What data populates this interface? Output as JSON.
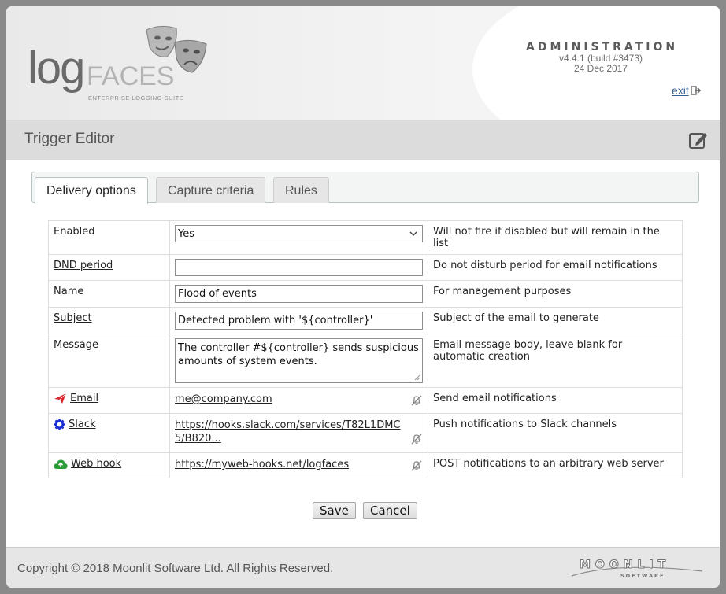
{
  "header": {
    "logo_main": "log",
    "logo_accent": "FACES",
    "logo_tagline": "ENTERPRISE LOGGING SUITE",
    "admin_title": "ADMINISTRATION",
    "version": "v4.4.1 (build #3473)",
    "date": "24 Dec 2017",
    "exit_label": "exit"
  },
  "section": {
    "title": "Trigger Editor"
  },
  "tabs": [
    {
      "label": "Delivery options",
      "active": true
    },
    {
      "label": "Capture criteria",
      "active": false
    },
    {
      "label": "Rules",
      "active": false
    }
  ],
  "form": {
    "enabled": {
      "label": "Enabled",
      "value": "Yes",
      "hint": "Will not fire if disabled but will remain in the list"
    },
    "dnd": {
      "label": "DND period",
      "value": "",
      "hint": "Do not disturb period for email notifications"
    },
    "name": {
      "label": "Name",
      "value": "Flood of events",
      "hint": "For management purposes"
    },
    "subject": {
      "label": "Subject",
      "value": "Detected problem with '${controller}'",
      "hint": "Subject of the email to generate"
    },
    "message": {
      "label": "Message",
      "value": "The controller #${controller} sends suspicious amounts of system events.",
      "hint": "Email message body, leave blank for automatic creation"
    },
    "email": {
      "label": "Email",
      "value": "me@company.com",
      "hint": "Send email notifications",
      "icon": "paper-plane-icon",
      "icon_color": "#d9252a"
    },
    "slack": {
      "label": "Slack",
      "value": "https://hooks.slack.com/services/T82L1DMC5/B820...",
      "hint": "Push notifications to Slack channels",
      "icon": "gear-icon",
      "icon_color": "#1a2fd6"
    },
    "webhook": {
      "label": "Web hook",
      "value": "https://myweb-hooks.net/logfaces",
      "hint": "POST notifications to an arbitrary web server",
      "icon": "cloud-upload-icon",
      "icon_color": "#2a9c3a"
    }
  },
  "buttons": {
    "save": "Save",
    "cancel": "Cancel"
  },
  "footer": {
    "copyright": "Copyright © 2018 Moonlit Software Ltd. All Rights Reserved.",
    "brand": "MOONLIT",
    "brand_sub": "SOFTWARE"
  }
}
